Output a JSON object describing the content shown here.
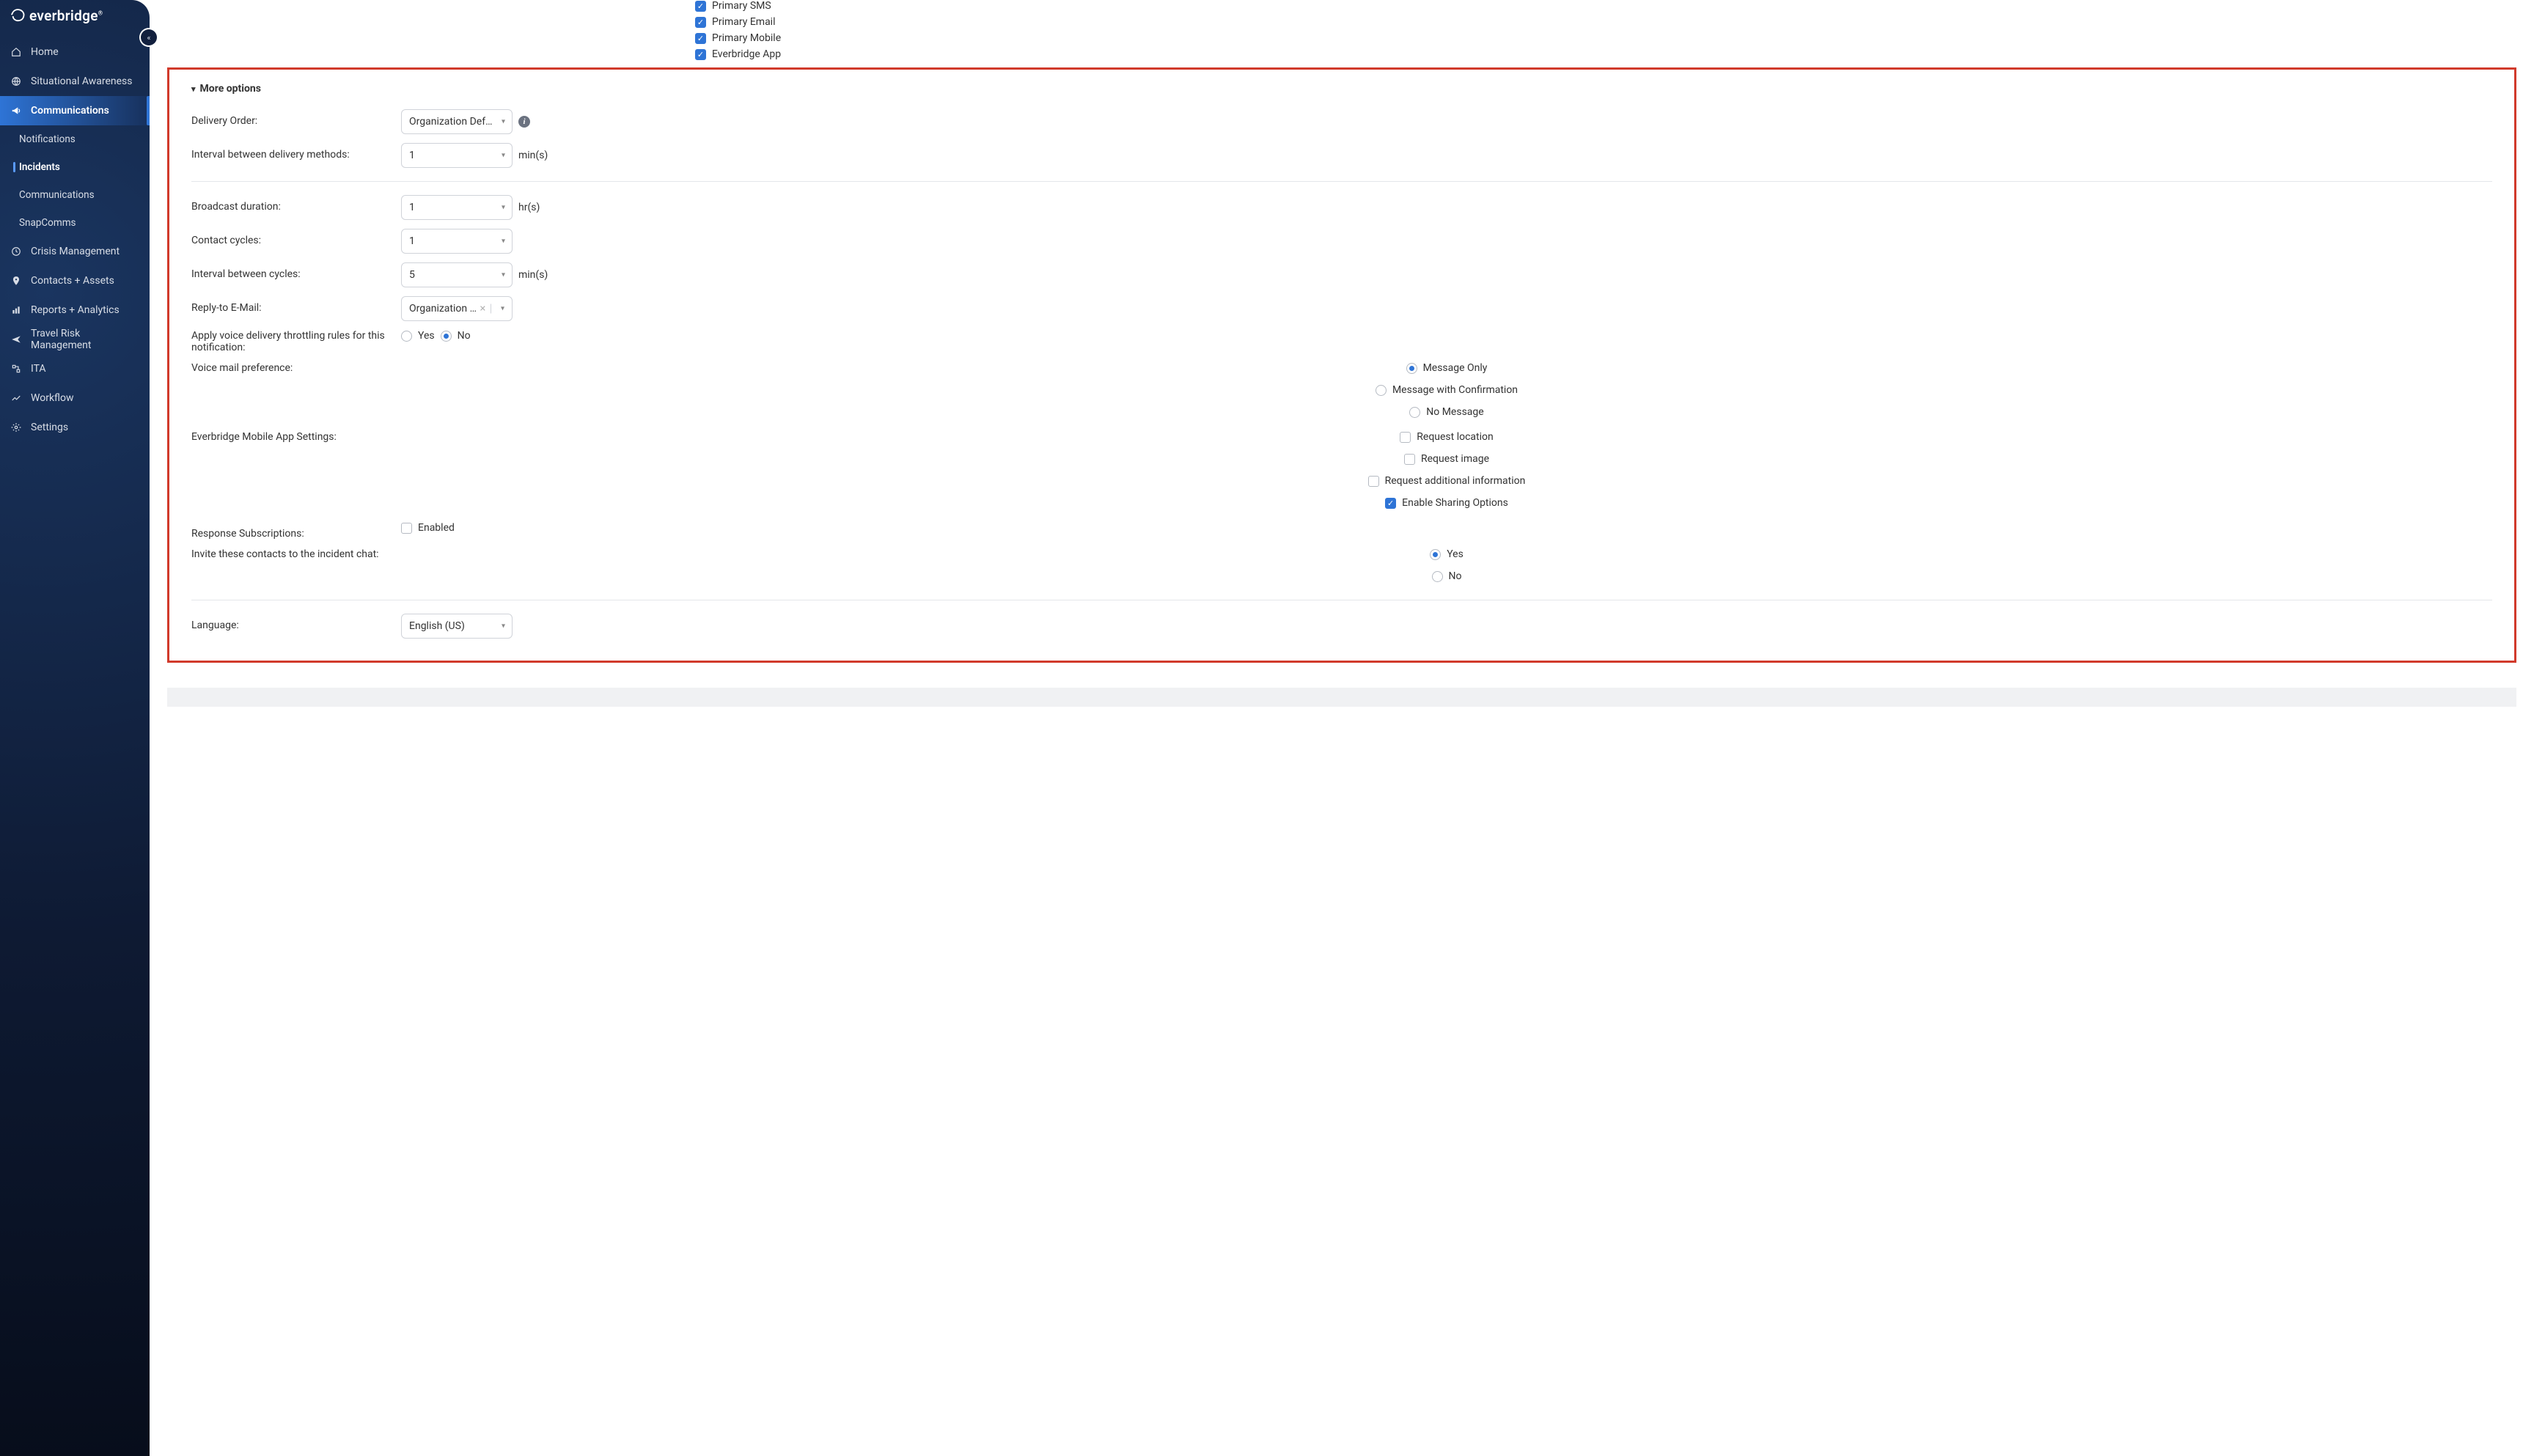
{
  "brand": {
    "name": "everbridge"
  },
  "sidebar": {
    "items": [
      {
        "label": "Home"
      },
      {
        "label": "Situational Awareness"
      },
      {
        "label": "Communications"
      },
      {
        "label": "Notifications"
      },
      {
        "label": "Incidents"
      },
      {
        "label": "Communications"
      },
      {
        "label": "SnapComms"
      },
      {
        "label": "Crisis Management"
      },
      {
        "label": "Contacts + Assets"
      },
      {
        "label": "Reports + Analytics"
      },
      {
        "label": "Travel Risk Management"
      },
      {
        "label": "ITA"
      },
      {
        "label": "Workflow"
      },
      {
        "label": "Settings"
      }
    ]
  },
  "delivery_methods": [
    {
      "label": "Primary SMS",
      "checked": true
    },
    {
      "label": "Primary Email",
      "checked": true
    },
    {
      "label": "Primary Mobile",
      "checked": true
    },
    {
      "label": "Everbridge App",
      "checked": true
    }
  ],
  "more_options": {
    "heading": "More options",
    "delivery_order": {
      "label": "Delivery Order:",
      "value": "Organization Default"
    },
    "interval_methods": {
      "label": "Interval between delivery methods:",
      "value": "1",
      "unit": "min(s)"
    },
    "broadcast": {
      "label": "Broadcast duration:",
      "value": "1",
      "unit": "hr(s)"
    },
    "contact_cycles": {
      "label": "Contact cycles:",
      "value": "1"
    },
    "interval_cycles": {
      "label": "Interval between cycles:",
      "value": "5",
      "unit": "min(s)"
    },
    "reply_email": {
      "label": "Reply-to E-Mail:",
      "value": "Organization …"
    },
    "throttling": {
      "label": "Apply voice delivery throttling rules for this notification:",
      "options": {
        "yes": "Yes",
        "no": "No"
      },
      "selected": "no"
    },
    "voicemail": {
      "label": "Voice mail preference:",
      "options": {
        "msg_only": "Message Only",
        "msg_conf": "Message with Confirmation",
        "no_msg": "No Message"
      },
      "selected": "msg_only"
    },
    "mobile_app": {
      "label": "Everbridge Mobile App Settings:",
      "options": [
        {
          "key": "request_location",
          "label": "Request location",
          "checked": false
        },
        {
          "key": "request_image",
          "label": "Request image",
          "checked": false
        },
        {
          "key": "request_addl_info",
          "label": "Request additional information",
          "checked": false
        },
        {
          "key": "enable_sharing",
          "label": "Enable Sharing Options",
          "checked": true
        }
      ]
    },
    "response_subs": {
      "label": "Response Subscriptions:",
      "option_label": "Enabled",
      "checked": false
    },
    "invite_chat": {
      "label": "Invite these contacts to the incident chat:",
      "options": {
        "yes": "Yes",
        "no": "No"
      },
      "selected": "yes"
    },
    "language": {
      "label": "Language:",
      "value": "English (US)"
    }
  }
}
